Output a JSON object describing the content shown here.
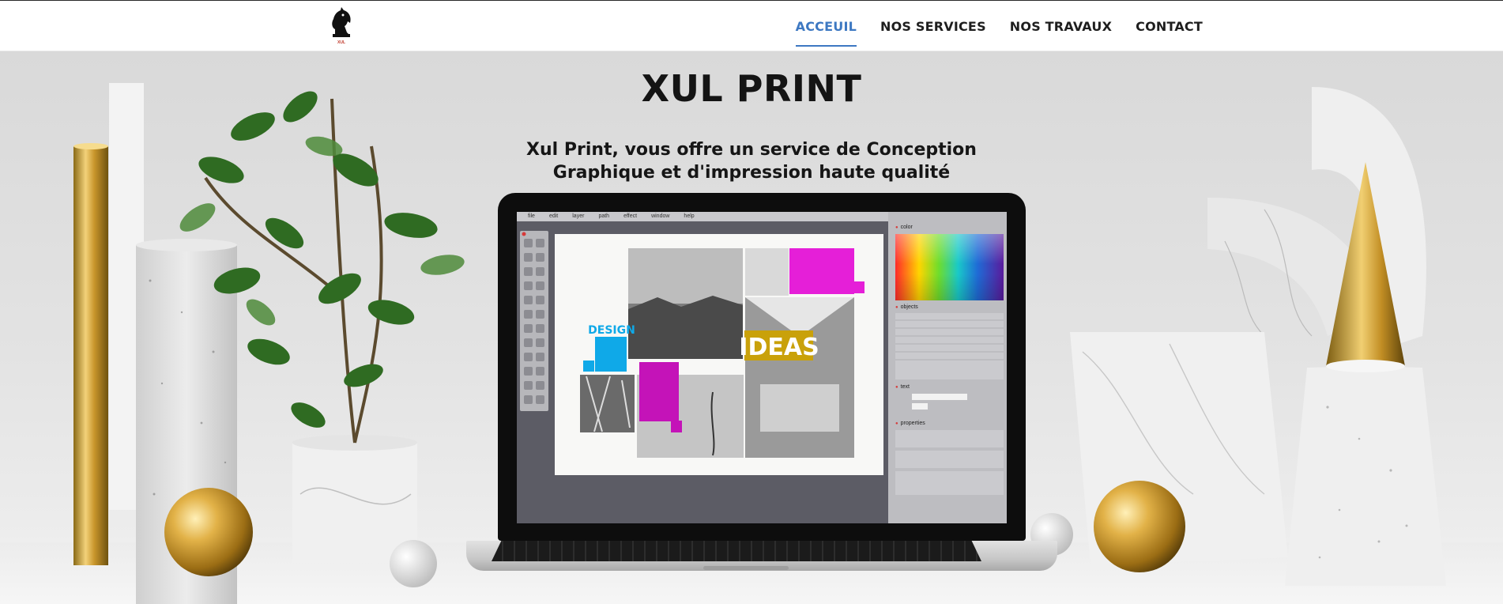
{
  "header": {
    "logo_text": "XUL PRINT",
    "nav": [
      {
        "label": "ACCEUIL",
        "active": true
      },
      {
        "label": "NOS SERVICES",
        "active": false
      },
      {
        "label": "NOS TRAVAUX",
        "active": false
      },
      {
        "label": "CONTACT",
        "active": false
      }
    ],
    "accent_color": "#3d78c2"
  },
  "hero": {
    "title": "XUL PRINT",
    "subtitle_line1": "Xul Print, vous offre un service de Conception",
    "subtitle_line2": "Graphique et d'impression haute qualité"
  },
  "laptop_screen": {
    "menu": [
      "file",
      "edit",
      "layer",
      "path",
      "effect",
      "window",
      "help"
    ],
    "panels": [
      "color",
      "objects",
      "text",
      "properties"
    ],
    "design_label": "DESIGN",
    "ideas_label": "IDEAS"
  }
}
